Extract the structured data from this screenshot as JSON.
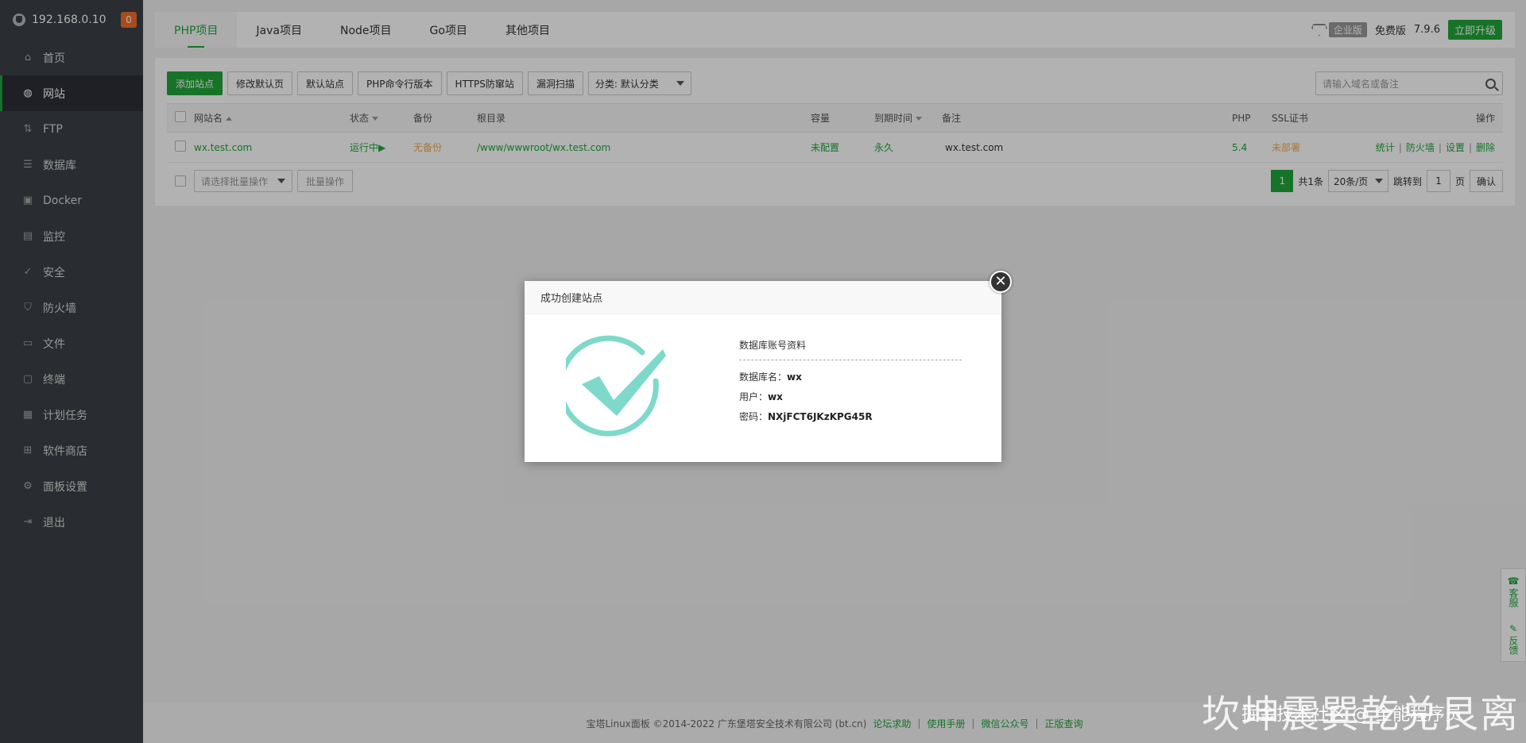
{
  "sidebar": {
    "host": "192.168.0.10",
    "badge": "0",
    "items": [
      {
        "label": "首页",
        "icon": "home-icon"
      },
      {
        "label": "网站",
        "icon": "globe-icon"
      },
      {
        "label": "FTP",
        "icon": "ftp-icon"
      },
      {
        "label": "数据库",
        "icon": "database-icon"
      },
      {
        "label": "Docker",
        "icon": "docker-icon"
      },
      {
        "label": "监控",
        "icon": "monitor-icon"
      },
      {
        "label": "安全",
        "icon": "shield-check-icon"
      },
      {
        "label": "防火墙",
        "icon": "firewall-icon"
      },
      {
        "label": "文件",
        "icon": "folder-icon"
      },
      {
        "label": "终端",
        "icon": "terminal-icon"
      },
      {
        "label": "计划任务",
        "icon": "calendar-icon"
      },
      {
        "label": "软件商店",
        "icon": "apps-icon"
      },
      {
        "label": "面板设置",
        "icon": "gear-icon"
      },
      {
        "label": "退出",
        "icon": "logout-icon"
      }
    ]
  },
  "tabs": [
    {
      "label": "PHP项目"
    },
    {
      "label": "Java项目"
    },
    {
      "label": "Node项目"
    },
    {
      "label": "Go项目"
    },
    {
      "label": "其他项目"
    }
  ],
  "header_right": {
    "enterprise": "企业版",
    "free": "免费版",
    "version": "7.9.6",
    "upgrade": "立即升级"
  },
  "toolbar": {
    "add_site": "添加站点",
    "edit_default_page": "修改默认页",
    "default_site": "默认站点",
    "php_cli": "PHP命令行版本",
    "https_guard": "HTTPS防窜站",
    "vuln_scan": "漏洞扫描",
    "category": "分类: 默认分类",
    "search_placeholder": "请输入域名或备注"
  },
  "table": {
    "headers": [
      "网站名",
      "状态",
      "备份",
      "根目录",
      "容量",
      "到期时间",
      "备注",
      "PHP",
      "SSL证书",
      "操作"
    ],
    "rows": [
      {
        "name": "wx.test.com",
        "status": "运行中▶",
        "backup": "无备份",
        "root": "/www/wwwroot/wx.test.com",
        "capacity": "未配置",
        "expire": "永久",
        "note": "wx.test.com",
        "php": "5.4",
        "ssl": "未部署",
        "ops": [
          "统计",
          "防火墙",
          "设置",
          "删除"
        ]
      }
    ]
  },
  "batch": {
    "select_placeholder": "请选择批量操作",
    "button": "批量操作"
  },
  "pager": {
    "current": "1",
    "total": "共1条",
    "per_page": "20条/页",
    "goto": "跳转到",
    "goto_value": "1",
    "page_unit": "页",
    "confirm": "确认"
  },
  "footer": {
    "copyright": "宝塔Linux面板 ©2014-2022 广东堡塔安全技术有限公司 (bt.cn)",
    "links": [
      "论坛求助",
      "使用手册",
      "微信公众号",
      "正版查询"
    ]
  },
  "float": {
    "service": "客服",
    "feedback": "反馈"
  },
  "modal": {
    "title": "成功创建站点",
    "info_title": "数据库账号资料",
    "db_name_label": "数据库名：",
    "db_name": "wx",
    "user_label": "用户：",
    "user": "wx",
    "pass_label": "密码：",
    "pass": "NXjFCT6JKzKPG45R",
    "check_color": "#7ed9cb"
  },
  "watermark": {
    "main": "坎坤震巽乾兑艮离",
    "sub": "掘金技术社区 @ 全能程序员"
  }
}
